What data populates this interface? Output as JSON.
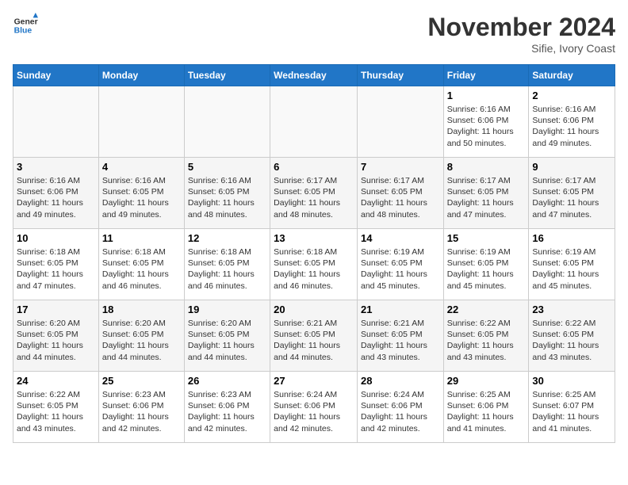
{
  "header": {
    "logo_line1": "General",
    "logo_line2": "Blue",
    "month_title": "November 2024",
    "location": "Sifie, Ivory Coast"
  },
  "days_of_week": [
    "Sunday",
    "Monday",
    "Tuesday",
    "Wednesday",
    "Thursday",
    "Friday",
    "Saturday"
  ],
  "weeks": [
    [
      {
        "day": "",
        "info": ""
      },
      {
        "day": "",
        "info": ""
      },
      {
        "day": "",
        "info": ""
      },
      {
        "day": "",
        "info": ""
      },
      {
        "day": "",
        "info": ""
      },
      {
        "day": "1",
        "info": "Sunrise: 6:16 AM\nSunset: 6:06 PM\nDaylight: 11 hours\nand 50 minutes."
      },
      {
        "day": "2",
        "info": "Sunrise: 6:16 AM\nSunset: 6:06 PM\nDaylight: 11 hours\nand 49 minutes."
      }
    ],
    [
      {
        "day": "3",
        "info": "Sunrise: 6:16 AM\nSunset: 6:06 PM\nDaylight: 11 hours\nand 49 minutes."
      },
      {
        "day": "4",
        "info": "Sunrise: 6:16 AM\nSunset: 6:05 PM\nDaylight: 11 hours\nand 49 minutes."
      },
      {
        "day": "5",
        "info": "Sunrise: 6:16 AM\nSunset: 6:05 PM\nDaylight: 11 hours\nand 48 minutes."
      },
      {
        "day": "6",
        "info": "Sunrise: 6:17 AM\nSunset: 6:05 PM\nDaylight: 11 hours\nand 48 minutes."
      },
      {
        "day": "7",
        "info": "Sunrise: 6:17 AM\nSunset: 6:05 PM\nDaylight: 11 hours\nand 48 minutes."
      },
      {
        "day": "8",
        "info": "Sunrise: 6:17 AM\nSunset: 6:05 PM\nDaylight: 11 hours\nand 47 minutes."
      },
      {
        "day": "9",
        "info": "Sunrise: 6:17 AM\nSunset: 6:05 PM\nDaylight: 11 hours\nand 47 minutes."
      }
    ],
    [
      {
        "day": "10",
        "info": "Sunrise: 6:18 AM\nSunset: 6:05 PM\nDaylight: 11 hours\nand 47 minutes."
      },
      {
        "day": "11",
        "info": "Sunrise: 6:18 AM\nSunset: 6:05 PM\nDaylight: 11 hours\nand 46 minutes."
      },
      {
        "day": "12",
        "info": "Sunrise: 6:18 AM\nSunset: 6:05 PM\nDaylight: 11 hours\nand 46 minutes."
      },
      {
        "day": "13",
        "info": "Sunrise: 6:18 AM\nSunset: 6:05 PM\nDaylight: 11 hours\nand 46 minutes."
      },
      {
        "day": "14",
        "info": "Sunrise: 6:19 AM\nSunset: 6:05 PM\nDaylight: 11 hours\nand 45 minutes."
      },
      {
        "day": "15",
        "info": "Sunrise: 6:19 AM\nSunset: 6:05 PM\nDaylight: 11 hours\nand 45 minutes."
      },
      {
        "day": "16",
        "info": "Sunrise: 6:19 AM\nSunset: 6:05 PM\nDaylight: 11 hours\nand 45 minutes."
      }
    ],
    [
      {
        "day": "17",
        "info": "Sunrise: 6:20 AM\nSunset: 6:05 PM\nDaylight: 11 hours\nand 44 minutes."
      },
      {
        "day": "18",
        "info": "Sunrise: 6:20 AM\nSunset: 6:05 PM\nDaylight: 11 hours\nand 44 minutes."
      },
      {
        "day": "19",
        "info": "Sunrise: 6:20 AM\nSunset: 6:05 PM\nDaylight: 11 hours\nand 44 minutes."
      },
      {
        "day": "20",
        "info": "Sunrise: 6:21 AM\nSunset: 6:05 PM\nDaylight: 11 hours\nand 44 minutes."
      },
      {
        "day": "21",
        "info": "Sunrise: 6:21 AM\nSunset: 6:05 PM\nDaylight: 11 hours\nand 43 minutes."
      },
      {
        "day": "22",
        "info": "Sunrise: 6:22 AM\nSunset: 6:05 PM\nDaylight: 11 hours\nand 43 minutes."
      },
      {
        "day": "23",
        "info": "Sunrise: 6:22 AM\nSunset: 6:05 PM\nDaylight: 11 hours\nand 43 minutes."
      }
    ],
    [
      {
        "day": "24",
        "info": "Sunrise: 6:22 AM\nSunset: 6:05 PM\nDaylight: 11 hours\nand 43 minutes."
      },
      {
        "day": "25",
        "info": "Sunrise: 6:23 AM\nSunset: 6:06 PM\nDaylight: 11 hours\nand 42 minutes."
      },
      {
        "day": "26",
        "info": "Sunrise: 6:23 AM\nSunset: 6:06 PM\nDaylight: 11 hours\nand 42 minutes."
      },
      {
        "day": "27",
        "info": "Sunrise: 6:24 AM\nSunset: 6:06 PM\nDaylight: 11 hours\nand 42 minutes."
      },
      {
        "day": "28",
        "info": "Sunrise: 6:24 AM\nSunset: 6:06 PM\nDaylight: 11 hours\nand 42 minutes."
      },
      {
        "day": "29",
        "info": "Sunrise: 6:25 AM\nSunset: 6:06 PM\nDaylight: 11 hours\nand 41 minutes."
      },
      {
        "day": "30",
        "info": "Sunrise: 6:25 AM\nSunset: 6:07 PM\nDaylight: 11 hours\nand 41 minutes."
      }
    ]
  ]
}
